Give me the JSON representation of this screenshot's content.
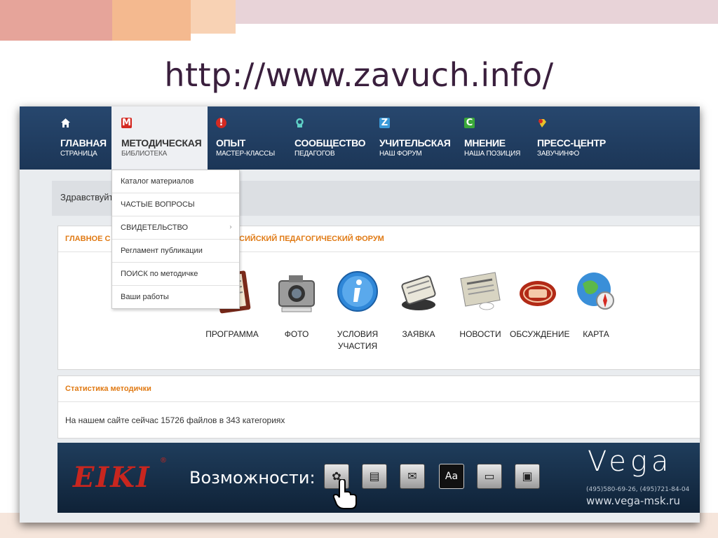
{
  "slide": {
    "title": "http://www.zavuch.info/"
  },
  "nav": [
    {
      "title": "ГЛАВНАЯ",
      "subtitle": "СТРАНИЦА",
      "icon": "home-icon"
    },
    {
      "title": "МЕТОДИЧЕСКАЯ",
      "subtitle": "БИБЛИОТЕКА",
      "icon": "library-m-icon",
      "icon_glyph": "M",
      "active": true
    },
    {
      "title": "ОПЫТ",
      "subtitle": "МАСТЕР-КЛАССЫ",
      "icon": "alert-icon",
      "icon_glyph": "!"
    },
    {
      "title": "СООБЩЕСТВО",
      "subtitle": "ПЕДАГОГОВ",
      "icon": "community-icon"
    },
    {
      "title": "УЧИТЕЛЬСКАЯ",
      "subtitle": "НАШ ФОРУМ",
      "icon": "forum-z-icon",
      "icon_glyph": "Z"
    },
    {
      "title": "МНЕНИЕ",
      "subtitle": "НАША ПОЗИЦИЯ",
      "icon": "opinion-c-icon",
      "icon_glyph": "C"
    },
    {
      "title": "ПРЕСС-ЦЕНТР",
      "subtitle": "ЗАВУЧИНФО",
      "icon": "press-icon"
    }
  ],
  "greeting": "Здравствуйт",
  "dropdown": [
    {
      "label": "Каталог материалов"
    },
    {
      "label": "ЧАСТЫЕ ВОПРОСЫ"
    },
    {
      "label": "СВИДЕТЕЛЬСТВО",
      "has_submenu": true
    },
    {
      "label": "Регламент публикации"
    },
    {
      "label": "ПОИСК по методичке"
    },
    {
      "label": "Ваши работы"
    }
  ],
  "main_panel": {
    "header_left": "ГЛАВНОЕ С",
    "header_right": "СИЙСКИЙ ПЕДАГОГИЧЕСКИЙ ФОРУМ",
    "features": [
      {
        "label": "ПРОГРАММА",
        "icon": "program-book-icon"
      },
      {
        "label": "ФОТО",
        "icon": "camera-icon"
      },
      {
        "label": "УСЛОВИЯ УЧАСТИЯ",
        "icon": "info-icon"
      },
      {
        "label": "ЗАЯВКА",
        "icon": "rolodex-icon"
      },
      {
        "label": "НОВОСТИ",
        "icon": "newspaper-icon"
      },
      {
        "label": "ОБСУЖДЕНИЕ",
        "icon": "discussion-sign-icon"
      },
      {
        "label": "КАРТА",
        "icon": "globe-compass-icon"
      }
    ]
  },
  "stats": {
    "title": "Статистика методички",
    "text": "На нашем сайте сейчас 15726 файлов в 343 категориях"
  },
  "banner": {
    "logo_text": "EIKI",
    "logo_mark": "®",
    "caption": "Возможности:",
    "buttons": [
      {
        "icon": "flower-icon",
        "glyph": "✿"
      },
      {
        "icon": "save-icon",
        "glyph": "▤"
      },
      {
        "icon": "envelope-icon",
        "glyph": "✉"
      },
      {
        "icon": "font-icon",
        "glyph": "Aa"
      },
      {
        "icon": "window-icon",
        "glyph": "▭"
      },
      {
        "icon": "image-icon",
        "glyph": "▣"
      }
    ],
    "brand": "Vega",
    "phones": "(495)580-69-26, (495)721-84-04",
    "site": "www.vega-msk.ru"
  }
}
